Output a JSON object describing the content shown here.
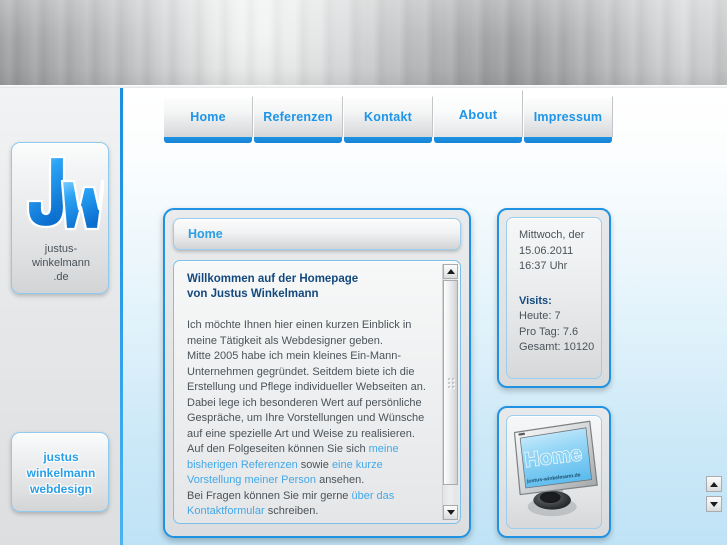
{
  "nav": {
    "tabs": [
      {
        "label": "Home",
        "active": false
      },
      {
        "label": "Referenzen",
        "active": false
      },
      {
        "label": "Kontakt",
        "active": false
      },
      {
        "label": "About",
        "active": true
      },
      {
        "label": "Impressum",
        "active": false
      }
    ]
  },
  "sidebar": {
    "logo": {
      "mark_text": "JW",
      "watermark_text": "justus",
      "caption_line1": "justus-",
      "caption_line2": "winkelmann",
      "caption_line3": ".de"
    },
    "brand": {
      "line1": "justus",
      "line2": "winkelmann",
      "line3": "webdesign"
    }
  },
  "main": {
    "panel_title": "Home",
    "article": {
      "heading_line1": "Willkommen auf der Homepage",
      "heading_line2": "von Justus Winkelmann",
      "p1": "Ich möchte Ihnen hier einen kurzen Einblick in meine Tätigkeit als Webdesigner geben.",
      "p2": "Mitte 2005 habe ich mein kleines Ein-Mann-Unternehmen gegründet. Seitdem biete ich die Erstellung und Pflege individueller Webseiten an. Dabei lege ich besonderen Wert auf persönliche Gespräche, um Ihre Vorstellungen und Wünsche auf eine spezielle Art und Weise zu realisieren.",
      "p3_before": "Auf den Folgeseiten können Sie sich ",
      "link_referenzen": "meine bisherigen Referenzen",
      "p3_middle": " sowie ",
      "link_vorstellung": "eine kurze Vorstellung meiner Person",
      "p3_after": " ansehen.",
      "p4_before": "Bei Fragen können Sie mir gerne ",
      "link_kontakt": "über das Kontaktformular",
      "p4_after": " schreiben."
    }
  },
  "info": {
    "date_line1": "Mittwoch, der",
    "date_line2": "15.06.2011",
    "date_line3": "16:37 Uhr",
    "visits_label": "Visits:",
    "visits_today": "Heute: 7",
    "visits_perday": "Pro Tag: 7.6",
    "visits_total": "Gesamt: 10120"
  },
  "media": {
    "screen_text": "Home",
    "screen_subtext": "justus-winkelmann.de"
  },
  "scrollbars": {
    "up_arrow": "▲",
    "down_arrow": "▼"
  },
  "colors": {
    "accent_blue": "#1f93e2",
    "link_blue": "#44a8e8",
    "heading_navy": "#14497e",
    "body_gray": "#4b5359"
  }
}
